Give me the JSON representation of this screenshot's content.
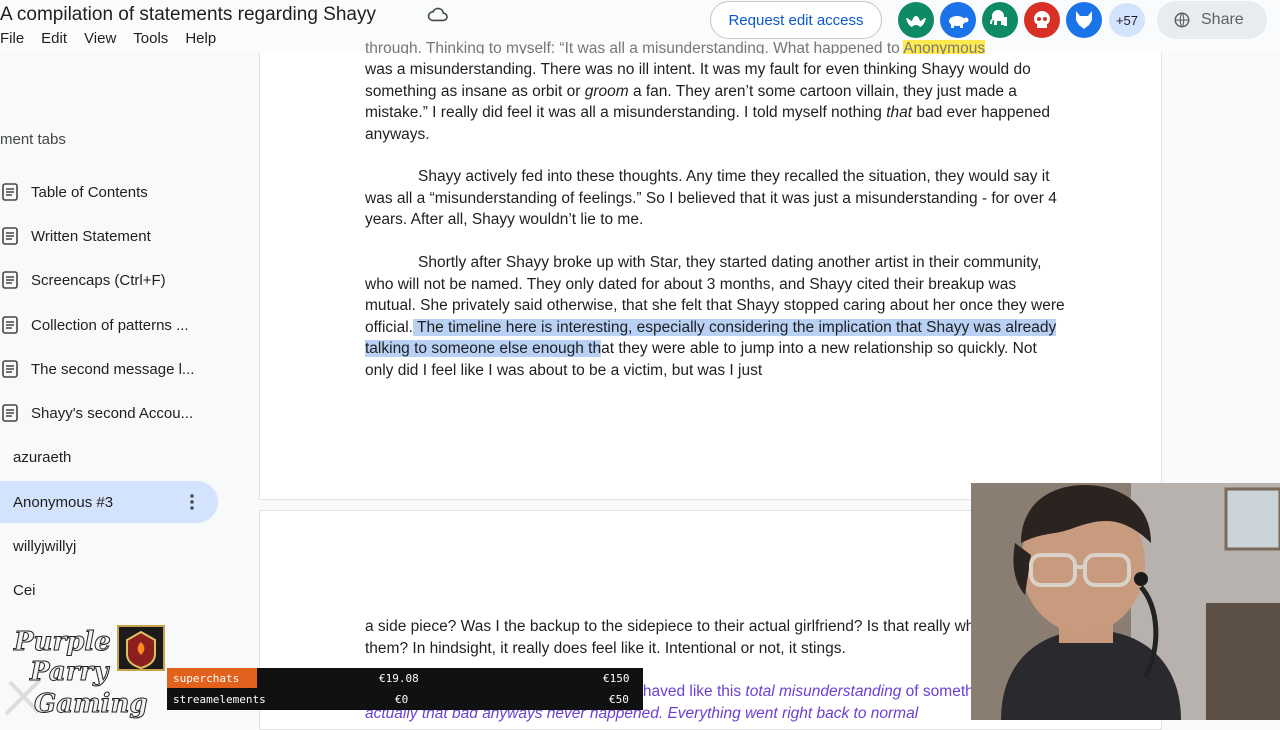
{
  "topbar": {
    "title": "A compilation of statements regarding Shayy",
    "menu": [
      "File",
      "Edit",
      "View",
      "Tools",
      "Help"
    ],
    "request_edit": "Request edit access",
    "more_count": "+57",
    "share": "Share",
    "avatars": [
      {
        "icon": "bat-icon",
        "color": "#0e8a64"
      },
      {
        "icon": "turtle-icon",
        "color": "#1a73e8"
      },
      {
        "icon": "elephant-icon",
        "color": "#0e8a64"
      },
      {
        "icon": "skull-icon",
        "color": "#d93025"
      },
      {
        "icon": "wolf-icon",
        "color": "#1a73e8"
      }
    ]
  },
  "sidebar": {
    "heading": "ment tabs",
    "tabs": [
      {
        "label": "Table of Contents"
      },
      {
        "label": "Written Statement"
      },
      {
        "label": "Screencaps (Ctrl+F)"
      },
      {
        "label": "Collection of patterns ..."
      },
      {
        "label": "The second message l..."
      },
      {
        "label": "Shayy's second Accou..."
      }
    ],
    "people": [
      {
        "label": "azuraeth"
      },
      {
        "label": "Anonymous #3"
      },
      {
        "label": "willyjwillyj"
      },
      {
        "label": "Cei"
      }
    ]
  },
  "doc": {
    "p0_top": "through. Thinking to myself: “It was all a misunderstanding. What happened to",
    "p0_yellow": "Anonymous",
    "p0_rest": "was a misunderstanding. There was no ill intent. It was my fault for even thinking Shayy would do something as insane as orbit or ",
    "p0_groom": "groom",
    "p0_tail": " a fan. They aren’t some cartoon villain, they just made a mistake.” I really did feel it was all a misunderstanding. I told myself nothing ",
    "p0_that": "that",
    "p0_end": " bad ever happened anyways.",
    "p1": "Shayy actively fed into these thoughts. Any time they recalled the situation, they would say it was all a “misunderstanding of feelings.” So I believed that it was just a misunderstanding - for over 4 years. After all, Shayy wouldn’t lie to me.",
    "p2_start": "Shortly after Shayy broke up with Star, they started dating another artist in their community, who will not be named. They only dated for about 3 months, and Shayy cited their breakup was mutual. She privately said otherwise, that she felt that Shayy stopped caring about her once they were official.",
    "p2_highlight": " The timeline here is interesting, especially considering the implication that Shayy was already talking to someone else enough th",
    "p2_end": "at they were able to jump into a new relationship so quickly. Not only did I feel like I was about to be a victim, but was I just",
    "p3": "a side piece? Was I the backup to the sidepiece to their actual girlfriend? Is that really what I was to them? In hindsight, it really does feel like it. Intentional or not, it stings.",
    "p4_a": "Even after all this, Shayy also behaved like this ",
    "p4_em": "total misunderstanding",
    "p4_b": " of something",
    "p4_c": " wasn't actually that bad anyways never happened. Everything went right back to normal"
  },
  "overlay": {
    "logo_text": "Purple Parry Gaming",
    "rows": [
      {
        "label": "superchats",
        "current": "€19.08",
        "goal": "€150"
      },
      {
        "label": "streamelements",
        "current": "€0",
        "goal": "€50"
      }
    ]
  }
}
